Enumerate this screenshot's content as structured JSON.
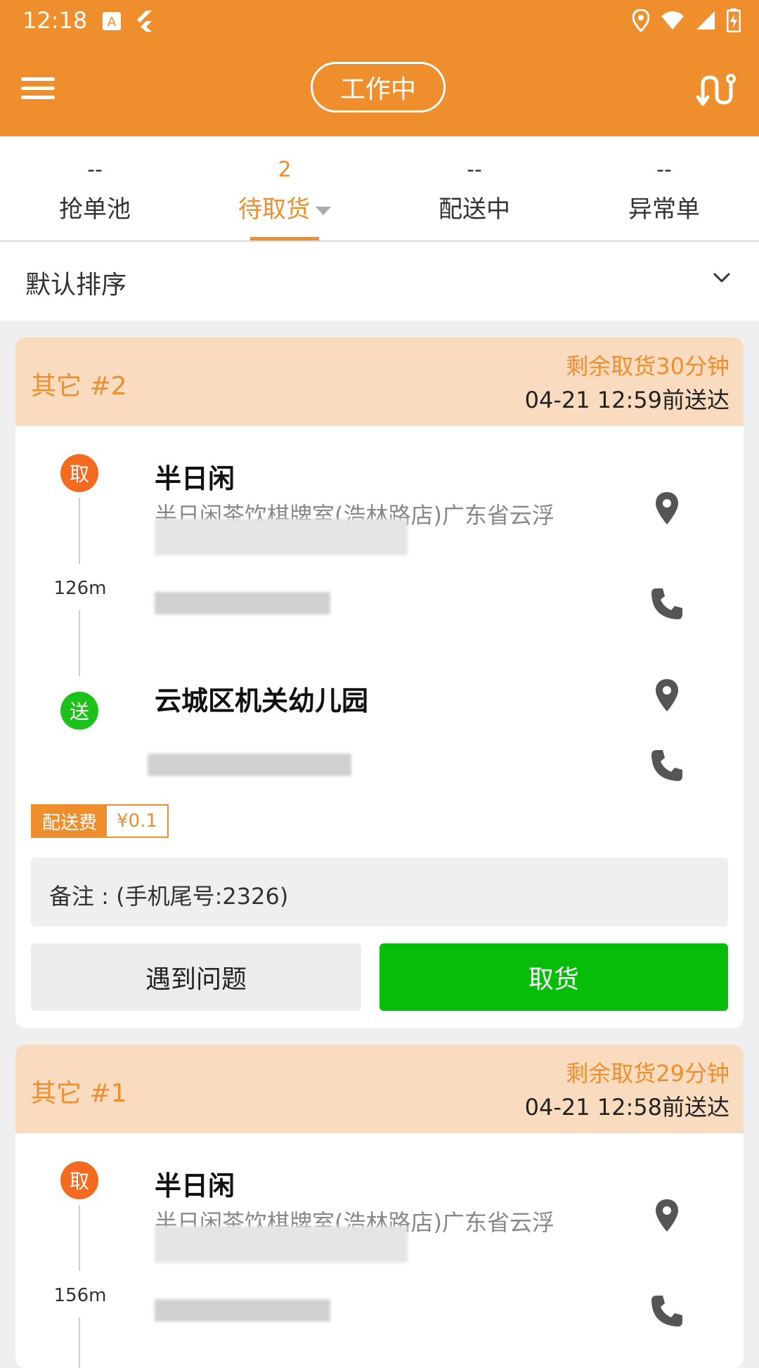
{
  "status_bar": {
    "time": "12:18",
    "colors": {
      "bar": "#ee8e2c"
    }
  },
  "app_bar": {
    "status_pill": "工作中",
    "icons": [
      "menu-icon",
      "route-icon"
    ]
  },
  "tabs": [
    {
      "count": "--",
      "label": "抢单池"
    },
    {
      "count": "2",
      "label": "待取货",
      "active": true
    },
    {
      "count": "--",
      "label": "配送中"
    },
    {
      "count": "--",
      "label": "异常单"
    }
  ],
  "sort": {
    "label": "默认排序"
  },
  "orders": [
    {
      "title": "其它 #2",
      "remaining": "剩余取货30分钟",
      "deadline": "04-21 12:59前送达",
      "pickup": {
        "badge": "取",
        "name": "半日闲",
        "address": "半日闲茶饮棋牌室(浩林路店)广东省云浮"
      },
      "distance": "126m",
      "dropoff": {
        "badge": "送",
        "name": "云城区机关幼儿园"
      },
      "fee_label": "配送费",
      "fee_value": "¥0.1",
      "note": "备注 : (手机尾号:2326)",
      "problem_button": "遇到问题",
      "pickup_button": "取货"
    },
    {
      "title": "其它 #1",
      "remaining": "剩余取货29分钟",
      "deadline": "04-21 12:58前送达",
      "pickup": {
        "badge": "取",
        "name": "半日闲",
        "address": "半日闲茶饮棋牌室(浩林路店)广东省云浮"
      },
      "distance": "156m"
    }
  ],
  "colors": {
    "accent": "#ee8e2c",
    "green": "#06bd0a",
    "pick_badge": "#f46a1f",
    "drop_badge": "#1cc21a"
  }
}
